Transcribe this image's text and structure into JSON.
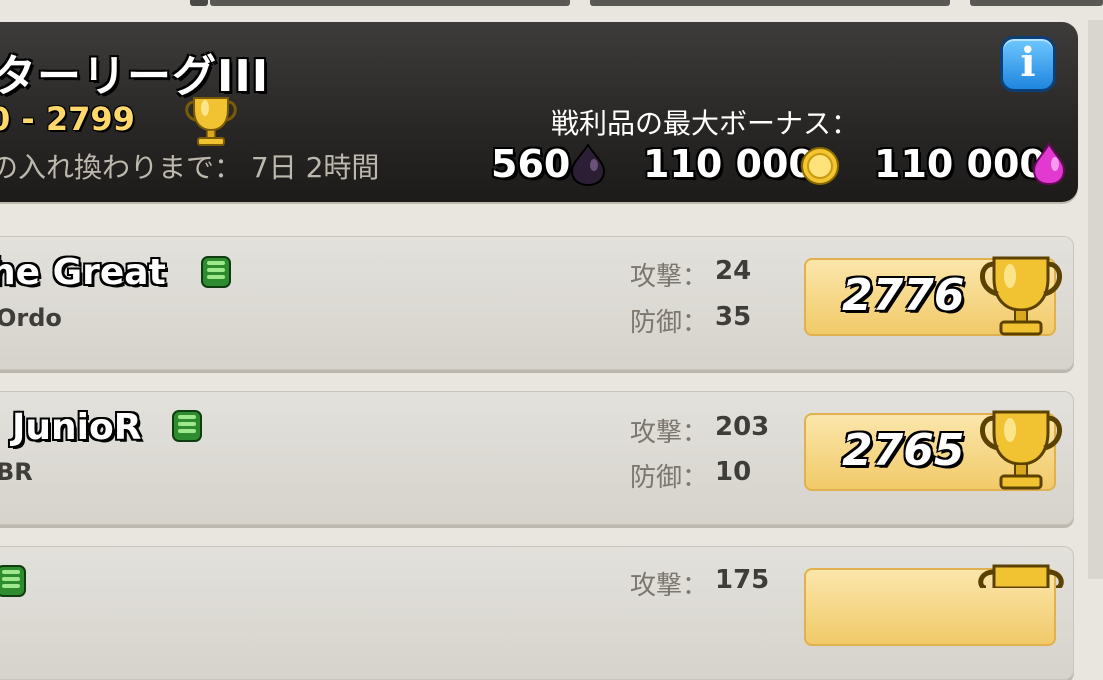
{
  "header": {
    "league_name": "ターリーグIII",
    "trophy_range": "0 - 2799",
    "reset_text": "の入れ換わりまで：  7日 2時間",
    "bonus_label": "戦利品の最大ボーナス：",
    "bonus": {
      "dark_elixir": "560",
      "gold": "110 000",
      "elixir": "110 000"
    },
    "info_label": "i"
  },
  "players": [
    {
      "name": "he Great",
      "clan": "Ordo",
      "attack_label": "攻撃：",
      "attack": "24",
      "defense_label": "防御：",
      "defense": "35",
      "trophies": "2776"
    },
    {
      "name": "JunioR",
      "clan": "BR",
      "attack_label": "攻撃：",
      "attack": "203",
      "defense_label": "防御：",
      "defense": "10",
      "trophies": "2765"
    },
    {
      "name": "",
      "clan": "",
      "attack_label": "攻撃：",
      "attack": "175",
      "defense_label": "",
      "defense": "",
      "trophies": ""
    }
  ],
  "colors": {
    "header_bg": "#2a2826",
    "row_bg": "#dcd9d2",
    "trophy_box": "#f4d27a",
    "range_text": "#ffd86b",
    "info_button": "#2b93e6"
  },
  "icons": [
    "trophy-icon",
    "info-icon",
    "dark-elixir-icon",
    "gold-coin-icon",
    "elixir-icon",
    "experience-icon"
  ]
}
